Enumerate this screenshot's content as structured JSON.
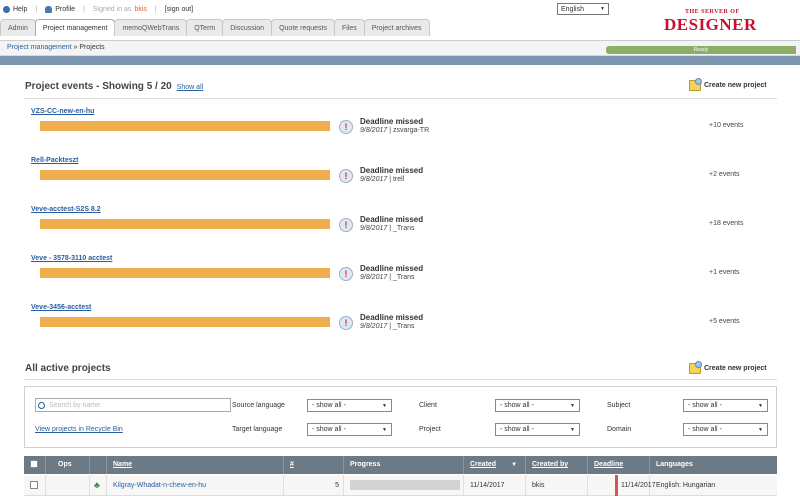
{
  "topbar": {
    "help": "Help",
    "profile": "Profile",
    "signed_in_as": "Signed in as",
    "user": "bkis",
    "sign_out": "[sign out]",
    "language": "English"
  },
  "logo": {
    "small": "THE SERVER OF",
    "big": "DESIGNER"
  },
  "tabs": [
    {
      "label": "Admin"
    },
    {
      "label": "Project management"
    },
    {
      "label": "memoQWebTrans"
    },
    {
      "label": "QTerm"
    },
    {
      "label": "Discussion"
    },
    {
      "label": "Quote requests"
    },
    {
      "label": "Files"
    },
    {
      "label": "Project archives"
    }
  ],
  "breadcrumb": {
    "parent": "Project management",
    "current": "» Projects"
  },
  "status_text": "Ready",
  "events_section": {
    "title": "Project events - Showing 5 / 20",
    "show_all": "Show all",
    "new_project": "Create new project",
    "events": [
      {
        "project": "VZS-CC-new-en-hu",
        "title": "Deadline missed",
        "date": "9/8/2017",
        "who": "| zsvarga-TR",
        "more": "+10 events"
      },
      {
        "project": "Rell-Packteszt",
        "title": "Deadline missed",
        "date": "9/8/2017",
        "who": "| trell",
        "more": "+2 events"
      },
      {
        "project": "Veve-acctest-S2S 8.2",
        "title": "Deadline missed",
        "date": "9/8/2017",
        "who": "| _Trans",
        "more": "+18 events"
      },
      {
        "project": "Veve - 3578-3110 acctest",
        "title": "Deadline missed",
        "date": "9/8/2017",
        "who": "| _Trans",
        "more": "+1 events"
      },
      {
        "project": "Veve-3456-acctest",
        "title": "Deadline missed",
        "date": "9/8/2017",
        "who": "| _Trans",
        "more": "+5 events"
      }
    ]
  },
  "active_section": {
    "title": "All active projects",
    "new_project": "Create new project"
  },
  "filters": {
    "search_placeholder": "Search by name",
    "recycle_bin": "View projects in Recycle Bin",
    "source_language": {
      "label": "Source language",
      "value": "- show all -"
    },
    "target_language": {
      "label": "Target language",
      "value": "- show all -"
    },
    "client": {
      "label": "Client",
      "value": "- show all -"
    },
    "project": {
      "label": "Project",
      "value": "- show all -"
    },
    "subject": {
      "label": "Subject",
      "value": "- show all -"
    },
    "domain": {
      "label": "Domain",
      "value": "- show all -"
    }
  },
  "table": {
    "headers": {
      "ops": "Ops",
      "name": "Name",
      "count": "#",
      "progress": "Progress",
      "created": "Created",
      "created_by": "Created by",
      "deadline": "Deadline",
      "languages": "Languages"
    },
    "rows": [
      {
        "name": "Kilgray-Whadat-n-chew-en-hu",
        "count": "5",
        "created": "11/14/2017",
        "created_by": "bkis",
        "deadline": "11/14/2017",
        "languages": "English: Hungarian"
      }
    ]
  }
}
